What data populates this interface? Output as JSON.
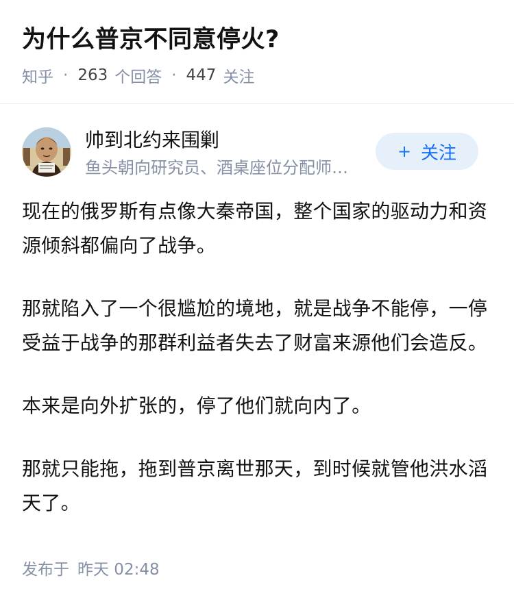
{
  "question": {
    "title": "为什么普京不同意停火?",
    "source": "知乎",
    "answer_count": "263",
    "answer_label": "个回答",
    "follow_count": "447",
    "follow_label": "关注",
    "separator": "·"
  },
  "author": {
    "name": "帅到北约来围剿",
    "bio": "鱼头朝向研究员、酒桌座位分配师…",
    "follow_button_label": "关注",
    "follow_button_icon": "plus-icon"
  },
  "answer": {
    "paragraphs": [
      "现在的俄罗斯有点像大秦帝国，整个国家的驱动力和资源倾斜都偏向了战争。",
      "那就陷入了一个很尴尬的境地，就是战争不能停，一停受益于战争的那群利益者失去了财富来源他们会造反。",
      "本来是向外扩张的，停了他们就向内了。",
      "那就只能拖，拖到普京离世那天，到时候就管他洪水滔天了。"
    ]
  },
  "footer": {
    "published_label": "发布于",
    "published_time": "昨天 02:48"
  },
  "colors": {
    "accent": "#1772f6",
    "accent_bg": "#e6f0fb",
    "meta_text": "#8590a6",
    "body_text": "#121212"
  }
}
